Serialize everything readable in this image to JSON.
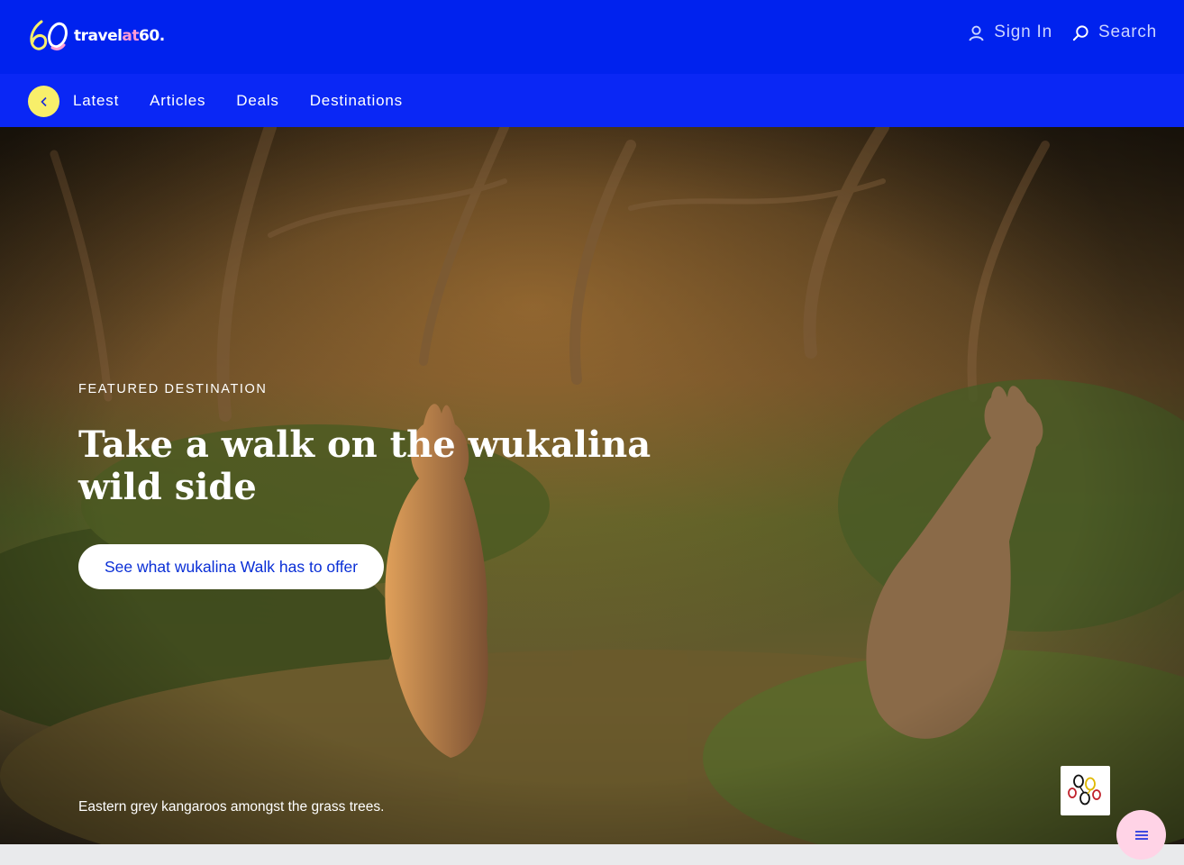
{
  "brand": {
    "logo_mark": "60",
    "name_prefix": "travel",
    "name_at": "at",
    "name_suffix": "60",
    "name_dot": ".",
    "colors": {
      "header": "#0022ee",
      "navbar": "#0a27f5",
      "accent_yellow": "#f8ef6a",
      "accent_pink": "#ff9ad5",
      "cta_text": "#0a2fd6"
    }
  },
  "header": {
    "sign_in": {
      "label": "Sign In",
      "icon": "user-icon"
    },
    "search": {
      "label": "Search",
      "icon": "search-icon"
    }
  },
  "nav": {
    "back_icon": "chevron-left-icon",
    "items": [
      "Latest",
      "Articles",
      "Deals",
      "Destinations"
    ]
  },
  "hero": {
    "eyebrow": "FEATURED DESTINATION",
    "title": "Take a walk on the wukalina wild side",
    "cta_label": "See what wukalina Walk has to offer",
    "caption": "Eastern grey kangaroos amongst the grass trees.",
    "badge_icon": "aboriginal-art-badge-icon"
  },
  "floating_menu": {
    "icon": "menu-icon"
  }
}
